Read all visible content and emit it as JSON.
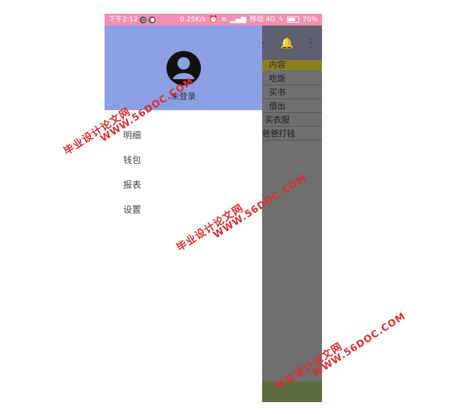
{
  "status_bar": {
    "time": "下午2:12",
    "speed": "0.25K/s",
    "carrier": "移动 4G",
    "battery": "70%"
  },
  "drawer": {
    "login_label": "未登录",
    "menu": [
      {
        "label": "明细"
      },
      {
        "label": "钱包"
      },
      {
        "label": "报表"
      },
      {
        "label": "设置"
      }
    ]
  },
  "background_list": {
    "header": "内容",
    "rows": [
      "吃饭",
      "买书",
      "借出",
      "买衣服",
      "爸爸打钱"
    ]
  },
  "watermark": {
    "cn": "毕业设计论文网",
    "en": "WWW.56DOC.COM"
  },
  "colors": {
    "status_bar": "#f48fb1",
    "drawer_header": "#8c9fe3",
    "scrim": "#6f6f6f",
    "watermark": "#d93030"
  }
}
